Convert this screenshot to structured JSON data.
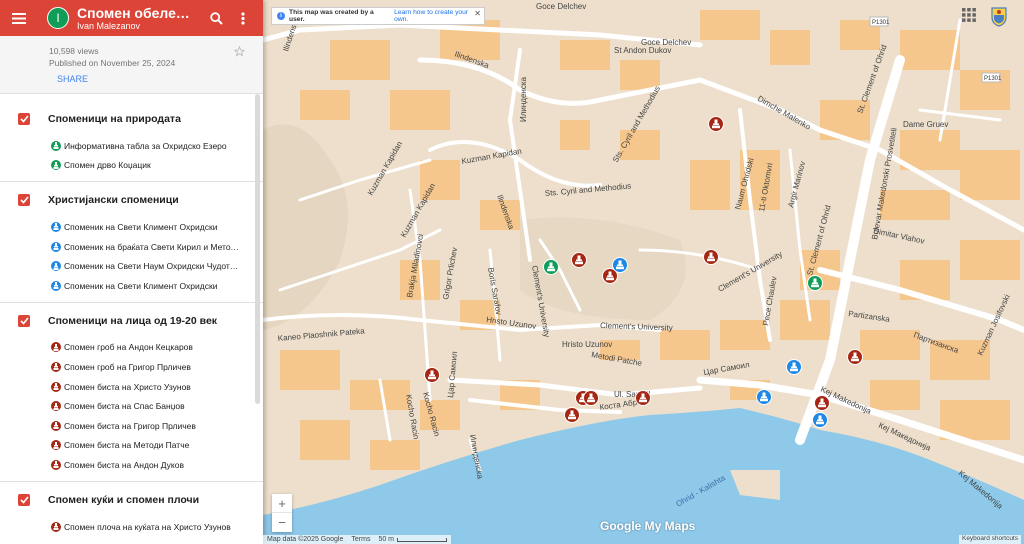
{
  "header": {
    "avatar_letter": "I",
    "title": "Спомен обележја во Охрид",
    "author": "Ivan Malezanov",
    "menu_icon": "hamburger-menu-icon",
    "search_icon": "search-icon",
    "more_icon": "more-vert-icon",
    "color": "#db4437"
  },
  "meta": {
    "views": "10,598 views",
    "published": "Published on November 25, 2024",
    "share_label": "SHARE"
  },
  "layers": [
    {
      "title": "Споменици на природата",
      "items": [
        {
          "label": "Информативна табла за Охридско Езеро",
          "color": "#0f9d58"
        },
        {
          "label": "Спомен дрво Коџацик",
          "color": "#0f9d58"
        }
      ]
    },
    {
      "title": "Христијански споменици",
      "items": [
        {
          "label": "Споменик на Свети Климент Охридски",
          "color": "#1e88e5"
        },
        {
          "label": "Споменик на браќата Свети Кирил и Методиј",
          "color": "#1e88e5"
        },
        {
          "label": "Споменик на Свети Наум Охридски Чудотворец",
          "color": "#1e88e5"
        },
        {
          "label": "Споменик на Свети Климент Охридски",
          "color": "#1e88e5"
        }
      ]
    },
    {
      "title": "Споменици на лица од 19-20 век",
      "items": [
        {
          "label": "Спомен гроб на Андон Кецкаров",
          "color": "#a52714"
        },
        {
          "label": "Спомен гроб на Григор Прличев",
          "color": "#a52714"
        },
        {
          "label": "Спомен биста на Христо Узунов",
          "color": "#a52714"
        },
        {
          "label": "Спомен биста на Спас Банџов",
          "color": "#a52714"
        },
        {
          "label": "Спомен биста на Григор Прличев",
          "color": "#a52714"
        },
        {
          "label": "Спомен биста на Методи Патче",
          "color": "#a52714"
        },
        {
          "label": "Спомен биста на Андон Дуков",
          "color": "#a52714"
        }
      ]
    },
    {
      "title": "Спомен куќи и спомен плочи",
      "items": [
        {
          "label": "Спомен плоча на куќата на Христо Узунов",
          "color": "#a52714"
        }
      ]
    }
  ],
  "banner": {
    "text": "This map was created by a user.",
    "link": "Learn how to create your own."
  },
  "streets": {
    "goce_delchev_1": "Goce Delchev",
    "goce_delchev_2": "Goce Delchev",
    "st_andon_dukov": "St Andon Dukov",
    "ilindenska_1": "Ilindenska",
    "ilindenska_2": "Ilindenska",
    "ilindenska_3": "Ilindenska",
    "ilindenska_cyr": "Илинденска",
    "ilindenska_cyr2": "Илинденска",
    "sts_cyril_1": "Sts. Cyril and Methodius",
    "sts_cyril_2": "Sts. Cyril and Methodius",
    "dimche_malenko": "Dimche Malenko",
    "kuzman_kapidan_1": "Kuzman Kapidan",
    "kuzman_kapidan_2": "Kuzman Kapidan",
    "kuzman_kapidan_3": "Kuzman Kapidan",
    "naum_ohridski": "Naum Ohridski",
    "oktomvri": "11-ti Oktomvri",
    "argir_marinov": "Argir Marinov",
    "bulevar": "Bulevar Makedonski Prosvetiteli",
    "st_clement_1": "St. Clement of Ohrid",
    "st_clement_2": "St. Clement of Ohrid",
    "dame_gruev": "Dame Gruev",
    "dimitar_vlahov": "Dimitar Vlahov",
    "brakja": "Brakja Miladinovci",
    "grigor_prlichev": "Grigor Prlichev",
    "boris_sarafov": "Boris Sarafov",
    "clements_univ_1": "Clement's University",
    "clements_univ_2": "Clement's University",
    "clements_univ_3": "Clement's University",
    "hristo_uzunov_1": "Hristo Uzunov",
    "hristo_uzunov_2": "Hristo Uzunov",
    "metodi_patche": "Metodi Patche",
    "partizanska": "Partizanska",
    "partizanska_cyr": "Партизанска",
    "kuzman_josifovski": "Kuzman Josifovski",
    "pece_chaulev": "Pece Chaulev",
    "kaneo": "Kaneo Plaoshnik Pateka",
    "car_samoil_1": "Цар Самоил",
    "car_samoil_2": "Цар Самоил",
    "car_samoil_3": "Цар Самоил",
    "kocho_racin": "Kocho Racin",
    "kosta_abrash_1": "Коста Абраш",
    "kosta_abrash_2": "Koста Абраш",
    "ul_samoil": "Ul. Samoil",
    "kej_1": "Kej Makedonija",
    "kej_2": "Кеј Македонија",
    "kej_3": "Kej Makedonija",
    "ohrid_kalishta": "Ohrid - Kalishta",
    "p1301_1": "P1301",
    "p1301_2": "P1301"
  },
  "map_markers": [
    {
      "kind": "red",
      "color": "#a52714"
    },
    {
      "kind": "red",
      "color": "#a52714"
    },
    {
      "kind": "red",
      "color": "#a52714"
    },
    {
      "kind": "red",
      "color": "#a52714"
    },
    {
      "kind": "red",
      "color": "#a52714"
    },
    {
      "kind": "red",
      "color": "#a52714"
    },
    {
      "kind": "red",
      "color": "#a52714"
    },
    {
      "kind": "red",
      "color": "#a52714"
    },
    {
      "kind": "red",
      "color": "#a52714"
    },
    {
      "kind": "red",
      "color": "#a52714"
    },
    {
      "kind": "red",
      "color": "#a52714"
    },
    {
      "kind": "green",
      "color": "#0f9d58"
    },
    {
      "kind": "green",
      "color": "#0f9d58"
    },
    {
      "kind": "blue",
      "color": "#1e88e5"
    },
    {
      "kind": "blue",
      "color": "#1e88e5"
    },
    {
      "kind": "blue",
      "color": "#1e88e5"
    },
    {
      "kind": "blue",
      "color": "#1e88e5"
    }
  ],
  "zoom": {
    "in": "+",
    "out": "−"
  },
  "logo": {
    "google": "Google",
    "mymaps": " My Maps"
  },
  "footer": {
    "attribution": "Map data ©2025 Google",
    "terms": "Terms",
    "scale": "50 m",
    "keyboard": "Keyboard shortcuts"
  },
  "colors": {
    "lake": "#8ec9ea",
    "land": "#eddfcb",
    "road": "#ffffff",
    "building": "#f6c78c",
    "accent": "#db4437"
  }
}
